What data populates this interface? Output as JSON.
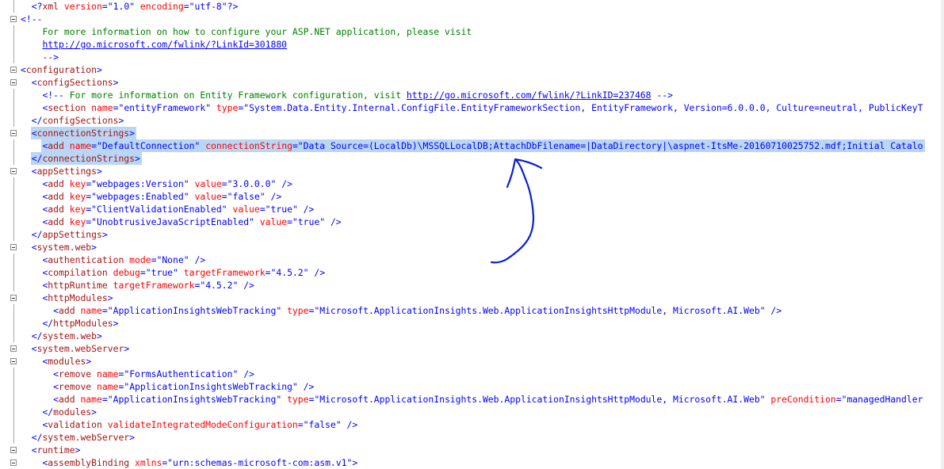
{
  "annotation": {
    "color": "#0b1fd0"
  },
  "colors": {
    "punct": "#0000ff",
    "tag": "#a31515",
    "attr": "#ff0000",
    "value": "#0000ff",
    "comment": "#008000",
    "selection": "#b9d6f5"
  },
  "lines": [
    {
      "indent": 2,
      "fold": false,
      "segments": [
        [
          "punct",
          "<?"
        ],
        [
          "tag",
          "xml"
        ],
        [
          "plain",
          " "
        ],
        [
          "attr",
          "version"
        ],
        [
          "punct",
          "=\""
        ],
        [
          "value",
          "1.0"
        ],
        [
          "punct",
          "\""
        ],
        [
          "plain",
          " "
        ],
        [
          "attr",
          "encoding"
        ],
        [
          "punct",
          "=\""
        ],
        [
          "value",
          "utf-8"
        ],
        [
          "punct",
          "\"?>"
        ]
      ]
    },
    {
      "indent": 0,
      "fold": true,
      "segments": [
        [
          "punct",
          "<!--"
        ]
      ]
    },
    {
      "indent": 4,
      "fold": false,
      "segments": [
        [
          "comment",
          "For more information on how to configure your ASP.NET application, please visit"
        ]
      ]
    },
    {
      "indent": 4,
      "fold": false,
      "segments": [
        [
          "link",
          "http://go.microsoft.com/fwlink/?LinkId=301880"
        ]
      ]
    },
    {
      "indent": 4,
      "fold": false,
      "segments": [
        [
          "punct",
          "-->"
        ]
      ]
    },
    {
      "indent": 0,
      "fold": true,
      "segments": [
        [
          "punct",
          "<"
        ],
        [
          "tag",
          "configuration"
        ],
        [
          "punct",
          ">"
        ]
      ]
    },
    {
      "indent": 2,
      "fold": true,
      "segments": [
        [
          "punct",
          "<"
        ],
        [
          "tag",
          "configSections"
        ],
        [
          "punct",
          ">"
        ]
      ]
    },
    {
      "indent": 4,
      "fold": false,
      "segments": [
        [
          "punct",
          "<!--"
        ],
        [
          "comment",
          " For more information on Entity Framework configuration, visit "
        ],
        [
          "link",
          "http://go.microsoft.com/fwlink/?LinkID=237468"
        ],
        [
          "comment",
          " "
        ],
        [
          "punct",
          "-->"
        ]
      ]
    },
    {
      "indent": 4,
      "fold": false,
      "segments": [
        [
          "punct",
          "<"
        ],
        [
          "tag",
          "section"
        ],
        [
          "plain",
          " "
        ],
        [
          "attr",
          "name"
        ],
        [
          "punct",
          "=\""
        ],
        [
          "value",
          "entityFramework"
        ],
        [
          "punct",
          "\""
        ],
        [
          "plain",
          " "
        ],
        [
          "attr",
          "type"
        ],
        [
          "punct",
          "=\""
        ],
        [
          "value",
          "System.Data.Entity.Internal.ConfigFile.EntityFrameworkSection, EntityFramework, Version=6.0.0.0, Culture=neutral, PublicKeyT"
        ]
      ]
    },
    {
      "indent": 2,
      "fold": false,
      "segments": [
        [
          "punct",
          "</"
        ],
        [
          "tag",
          "configSections"
        ],
        [
          "punct",
          ">"
        ]
      ]
    },
    {
      "indent": 2,
      "fold": true,
      "selected": true,
      "segments": [
        [
          "punct",
          "<"
        ],
        [
          "tag",
          "connectionStrings"
        ],
        [
          "punct",
          ">"
        ]
      ]
    },
    {
      "indent": 4,
      "fold": false,
      "selected": true,
      "segments": [
        [
          "punct",
          "<"
        ],
        [
          "tag",
          "add"
        ],
        [
          "plain",
          " "
        ],
        [
          "attr",
          "name"
        ],
        [
          "punct",
          "=\""
        ],
        [
          "value",
          "DefaultConnection"
        ],
        [
          "punct",
          "\""
        ],
        [
          "plain",
          " "
        ],
        [
          "attr",
          "connectionString"
        ],
        [
          "punct",
          "=\""
        ],
        [
          "value",
          "Data Source=(LocalDb)\\MSSQLLocalDB;AttachDbFilename=|DataDirectory|\\aspnet-ItsMe-20160710025752.mdf;Initial Catalo"
        ]
      ]
    },
    {
      "indent": 2,
      "fold": false,
      "selected": true,
      "segments": [
        [
          "punct",
          "</"
        ],
        [
          "tag",
          "connectionStrings"
        ],
        [
          "punct",
          ">"
        ]
      ]
    },
    {
      "indent": 2,
      "fold": true,
      "segments": [
        [
          "punct",
          "<"
        ],
        [
          "tag",
          "appSettings"
        ],
        [
          "punct",
          ">"
        ]
      ]
    },
    {
      "indent": 4,
      "fold": false,
      "segments": [
        [
          "punct",
          "<"
        ],
        [
          "tag",
          "add"
        ],
        [
          "plain",
          " "
        ],
        [
          "attr",
          "key"
        ],
        [
          "punct",
          "=\""
        ],
        [
          "value",
          "webpages:Version"
        ],
        [
          "punct",
          "\""
        ],
        [
          "plain",
          " "
        ],
        [
          "attr",
          "value"
        ],
        [
          "punct",
          "=\""
        ],
        [
          "value",
          "3.0.0.0"
        ],
        [
          "punct",
          "\" />"
        ]
      ]
    },
    {
      "indent": 4,
      "fold": false,
      "segments": [
        [
          "punct",
          "<"
        ],
        [
          "tag",
          "add"
        ],
        [
          "plain",
          " "
        ],
        [
          "attr",
          "key"
        ],
        [
          "punct",
          "=\""
        ],
        [
          "value",
          "webpages:Enabled"
        ],
        [
          "punct",
          "\""
        ],
        [
          "plain",
          " "
        ],
        [
          "attr",
          "value"
        ],
        [
          "punct",
          "=\""
        ],
        [
          "value",
          "false"
        ],
        [
          "punct",
          "\" />"
        ]
      ]
    },
    {
      "indent": 4,
      "fold": false,
      "segments": [
        [
          "punct",
          "<"
        ],
        [
          "tag",
          "add"
        ],
        [
          "plain",
          " "
        ],
        [
          "attr",
          "key"
        ],
        [
          "punct",
          "=\""
        ],
        [
          "value",
          "ClientValidationEnabled"
        ],
        [
          "punct",
          "\""
        ],
        [
          "plain",
          " "
        ],
        [
          "attr",
          "value"
        ],
        [
          "punct",
          "=\""
        ],
        [
          "value",
          "true"
        ],
        [
          "punct",
          "\" />"
        ]
      ]
    },
    {
      "indent": 4,
      "fold": false,
      "segments": [
        [
          "punct",
          "<"
        ],
        [
          "tag",
          "add"
        ],
        [
          "plain",
          " "
        ],
        [
          "attr",
          "key"
        ],
        [
          "punct",
          "=\""
        ],
        [
          "value",
          "UnobtrusiveJavaScriptEnabled"
        ],
        [
          "punct",
          "\""
        ],
        [
          "plain",
          " "
        ],
        [
          "attr",
          "value"
        ],
        [
          "punct",
          "=\""
        ],
        [
          "value",
          "true"
        ],
        [
          "punct",
          "\" />"
        ]
      ]
    },
    {
      "indent": 2,
      "fold": false,
      "segments": [
        [
          "punct",
          "</"
        ],
        [
          "tag",
          "appSettings"
        ],
        [
          "punct",
          ">"
        ]
      ]
    },
    {
      "indent": 2,
      "fold": true,
      "segments": [
        [
          "punct",
          "<"
        ],
        [
          "tag",
          "system.web"
        ],
        [
          "punct",
          ">"
        ]
      ]
    },
    {
      "indent": 4,
      "fold": false,
      "segments": [
        [
          "punct",
          "<"
        ],
        [
          "tag",
          "authentication"
        ],
        [
          "plain",
          " "
        ],
        [
          "attr",
          "mode"
        ],
        [
          "punct",
          "=\""
        ],
        [
          "value",
          "None"
        ],
        [
          "punct",
          "\" />"
        ]
      ]
    },
    {
      "indent": 4,
      "fold": false,
      "segments": [
        [
          "punct",
          "<"
        ],
        [
          "tag",
          "compilation"
        ],
        [
          "plain",
          " "
        ],
        [
          "attr",
          "debug"
        ],
        [
          "punct",
          "=\""
        ],
        [
          "value",
          "true"
        ],
        [
          "punct",
          "\""
        ],
        [
          "plain",
          " "
        ],
        [
          "attr",
          "targetFramework"
        ],
        [
          "punct",
          "=\""
        ],
        [
          "value",
          "4.5.2"
        ],
        [
          "punct",
          "\" />"
        ]
      ]
    },
    {
      "indent": 4,
      "fold": false,
      "segments": [
        [
          "punct",
          "<"
        ],
        [
          "tag",
          "httpRuntime"
        ],
        [
          "plain",
          " "
        ],
        [
          "attr",
          "targetFramework"
        ],
        [
          "punct",
          "=\""
        ],
        [
          "value",
          "4.5.2"
        ],
        [
          "punct",
          "\" />"
        ]
      ]
    },
    {
      "indent": 4,
      "fold": true,
      "segments": [
        [
          "punct",
          "<"
        ],
        [
          "tag",
          "httpModules"
        ],
        [
          "punct",
          ">"
        ]
      ]
    },
    {
      "indent": 6,
      "fold": false,
      "segments": [
        [
          "punct",
          "<"
        ],
        [
          "tag",
          "add"
        ],
        [
          "plain",
          " "
        ],
        [
          "attr",
          "name"
        ],
        [
          "punct",
          "=\""
        ],
        [
          "value",
          "ApplicationInsightsWebTracking"
        ],
        [
          "punct",
          "\""
        ],
        [
          "plain",
          " "
        ],
        [
          "attr",
          "type"
        ],
        [
          "punct",
          "=\""
        ],
        [
          "value",
          "Microsoft.ApplicationInsights.Web.ApplicationInsightsHttpModule, Microsoft.AI.Web"
        ],
        [
          "punct",
          "\" />"
        ]
      ]
    },
    {
      "indent": 4,
      "fold": false,
      "segments": [
        [
          "punct",
          "</"
        ],
        [
          "tag",
          "httpModules"
        ],
        [
          "punct",
          ">"
        ]
      ]
    },
    {
      "indent": 2,
      "fold": false,
      "segments": [
        [
          "punct",
          "</"
        ],
        [
          "tag",
          "system.web"
        ],
        [
          "punct",
          ">"
        ]
      ]
    },
    {
      "indent": 2,
      "fold": true,
      "segments": [
        [
          "punct",
          "<"
        ],
        [
          "tag",
          "system.webServer"
        ],
        [
          "punct",
          ">"
        ]
      ]
    },
    {
      "indent": 4,
      "fold": true,
      "segments": [
        [
          "punct",
          "<"
        ],
        [
          "tag",
          "modules"
        ],
        [
          "punct",
          ">"
        ]
      ]
    },
    {
      "indent": 6,
      "fold": false,
      "segments": [
        [
          "punct",
          "<"
        ],
        [
          "tag",
          "remove"
        ],
        [
          "plain",
          " "
        ],
        [
          "attr",
          "name"
        ],
        [
          "punct",
          "=\""
        ],
        [
          "value",
          "FormsAuthentication"
        ],
        [
          "punct",
          "\" />"
        ]
      ]
    },
    {
      "indent": 6,
      "fold": false,
      "segments": [
        [
          "punct",
          "<"
        ],
        [
          "tag",
          "remove"
        ],
        [
          "plain",
          " "
        ],
        [
          "attr",
          "name"
        ],
        [
          "punct",
          "=\""
        ],
        [
          "value",
          "ApplicationInsightsWebTracking"
        ],
        [
          "punct",
          "\" />"
        ]
      ]
    },
    {
      "indent": 6,
      "fold": false,
      "segments": [
        [
          "punct",
          "<"
        ],
        [
          "tag",
          "add"
        ],
        [
          "plain",
          " "
        ],
        [
          "attr",
          "name"
        ],
        [
          "punct",
          "=\""
        ],
        [
          "value",
          "ApplicationInsightsWebTracking"
        ],
        [
          "punct",
          "\""
        ],
        [
          "plain",
          " "
        ],
        [
          "attr",
          "type"
        ],
        [
          "punct",
          "=\""
        ],
        [
          "value",
          "Microsoft.ApplicationInsights.Web.ApplicationInsightsHttpModule, Microsoft.AI.Web"
        ],
        [
          "punct",
          "\""
        ],
        [
          "plain",
          " "
        ],
        [
          "attr",
          "preCondition"
        ],
        [
          "punct",
          "=\""
        ],
        [
          "value",
          "managedHandler"
        ]
      ]
    },
    {
      "indent": 4,
      "fold": false,
      "segments": [
        [
          "punct",
          "</"
        ],
        [
          "tag",
          "modules"
        ],
        [
          "punct",
          ">"
        ]
      ]
    },
    {
      "indent": 4,
      "fold": false,
      "segments": [
        [
          "punct",
          "<"
        ],
        [
          "tag",
          "validation"
        ],
        [
          "plain",
          " "
        ],
        [
          "attr",
          "validateIntegratedModeConfiguration"
        ],
        [
          "punct",
          "=\""
        ],
        [
          "value",
          "false"
        ],
        [
          "punct",
          "\" />"
        ]
      ]
    },
    {
      "indent": 2,
      "fold": false,
      "segments": [
        [
          "punct",
          "</"
        ],
        [
          "tag",
          "system.webServer"
        ],
        [
          "punct",
          ">"
        ]
      ]
    },
    {
      "indent": 2,
      "fold": true,
      "segments": [
        [
          "punct",
          "<"
        ],
        [
          "tag",
          "runtime"
        ],
        [
          "punct",
          ">"
        ]
      ]
    },
    {
      "indent": 4,
      "fold": true,
      "segments": [
        [
          "punct",
          "<"
        ],
        [
          "tag",
          "assemblyBinding"
        ],
        [
          "plain",
          " "
        ],
        [
          "attr",
          "xmlns"
        ],
        [
          "punct",
          "=\""
        ],
        [
          "value",
          "urn:schemas-microsoft-com:asm.v1"
        ],
        [
          "punct",
          "\">"
        ]
      ]
    }
  ]
}
